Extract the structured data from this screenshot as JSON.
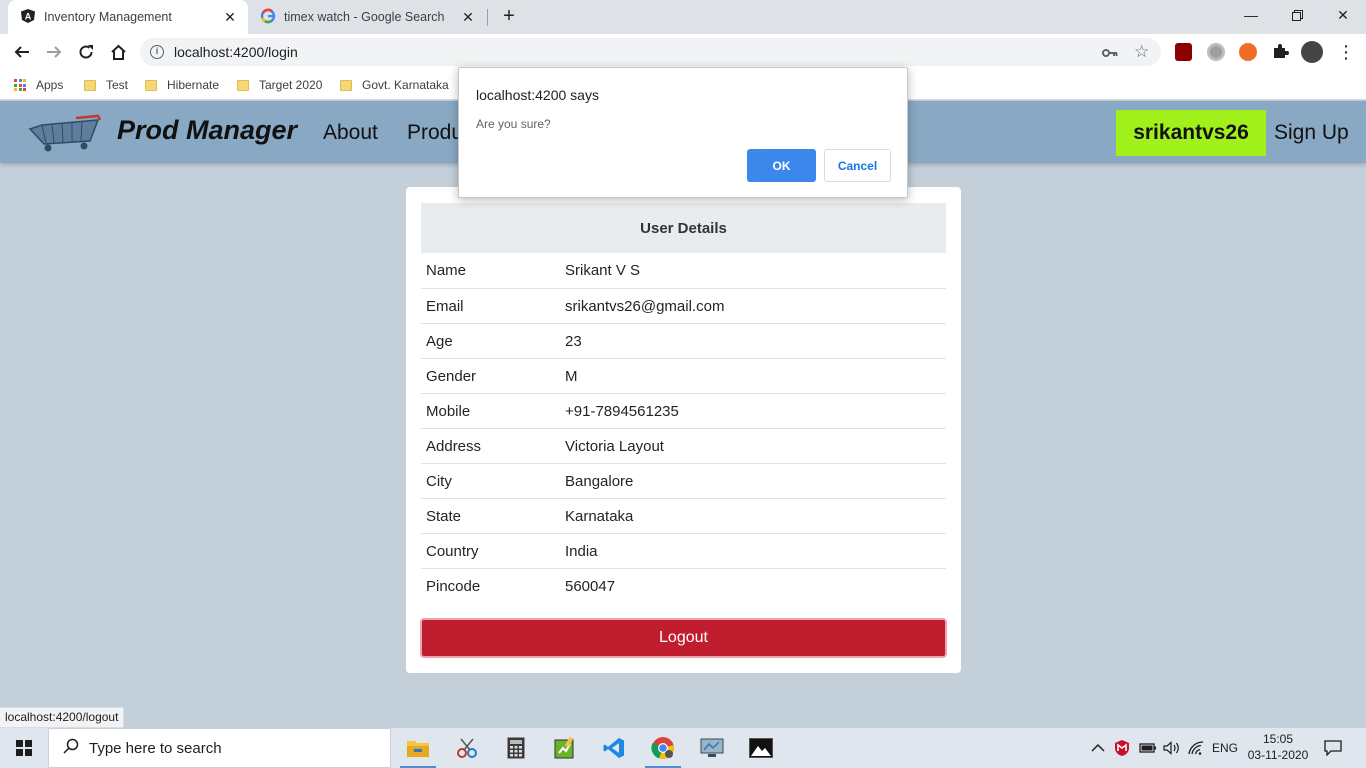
{
  "browser": {
    "tabs": [
      {
        "title": "Inventory Management",
        "active": true,
        "icon": "angular-icon"
      },
      {
        "title": "timex watch - Google Search",
        "active": false,
        "icon": "google-icon"
      }
    ],
    "url": "localhost:4200/login",
    "bookmarks": [
      {
        "label": "Apps",
        "icon": "apps-grid-icon"
      },
      {
        "label": "Test",
        "icon": "folder-icon"
      },
      {
        "label": "Hibernate",
        "icon": "folder-icon"
      },
      {
        "label": "Target 2020",
        "icon": "folder-icon"
      },
      {
        "label": "Govt. Karnataka",
        "icon": "folder-icon"
      }
    ],
    "status_url": "localhost:4200/logout"
  },
  "app": {
    "brand": "Prod Manager",
    "nav": [
      "About",
      "Produ"
    ],
    "username": "srikantvs26",
    "signup": "Sign Up",
    "brand_color": "#88a8c4",
    "user_button_color": "#a1f01b"
  },
  "card": {
    "header": "User Details",
    "rows": [
      {
        "label": "Name",
        "value": "Srikant V S"
      },
      {
        "label": "Email",
        "value": "srikantvs26@gmail.com"
      },
      {
        "label": "Age",
        "value": "23"
      },
      {
        "label": "Gender",
        "value": "M"
      },
      {
        "label": "Mobile",
        "value": "+91-7894561235"
      },
      {
        "label": "Address",
        "value": "Victoria Layout"
      },
      {
        "label": "City",
        "value": "Bangalore"
      },
      {
        "label": "State",
        "value": "Karnataka"
      },
      {
        "label": "Country",
        "value": "India"
      },
      {
        "label": "Pincode",
        "value": "560047"
      }
    ],
    "logout": "Logout",
    "logout_color": "#c01e2e"
  },
  "dialog": {
    "title": "localhost:4200 says",
    "message": "Are you sure?",
    "ok": "OK",
    "cancel": "Cancel"
  },
  "taskbar": {
    "search_placeholder": "Type here to search",
    "language": "ENG",
    "time": "15:05",
    "date": "03-11-2020"
  }
}
